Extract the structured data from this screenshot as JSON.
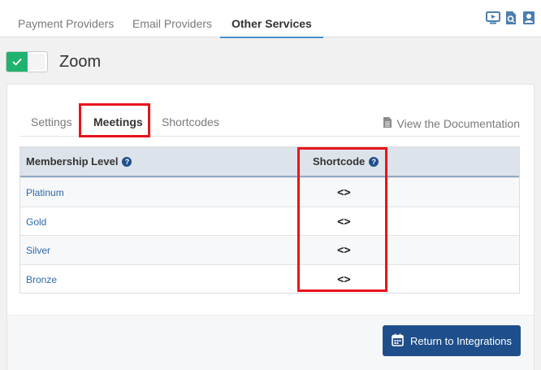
{
  "top_tabs": [
    {
      "label": "Payment Providers"
    },
    {
      "label": "Email Providers"
    },
    {
      "label": "Other Services"
    }
  ],
  "integration": {
    "title": "Zoom",
    "enabled": true
  },
  "sub_tabs": [
    {
      "label": "Settings"
    },
    {
      "label": "Meetings"
    },
    {
      "label": "Shortcodes"
    }
  ],
  "doc_link": "View the Documentation",
  "table": {
    "col_level": "Membership Level",
    "col_shortcode": "Shortcode",
    "rows": [
      {
        "level": "Platinum",
        "code": "<>"
      },
      {
        "level": "Gold",
        "code": "<>"
      },
      {
        "level": "Silver",
        "code": "<>"
      },
      {
        "level": "Bronze",
        "code": "<>"
      }
    ]
  },
  "return_button": "Return to Integrations",
  "colors": {
    "accent": "#1f4f8a",
    "toggle_on": "#1fb36f",
    "highlight": "#e8141b",
    "link": "#2d6aa6"
  }
}
